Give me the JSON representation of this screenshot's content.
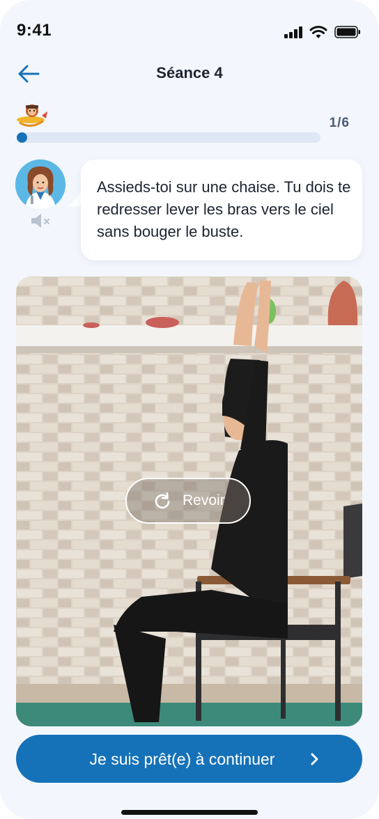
{
  "status_bar": {
    "time": "9:41"
  },
  "header": {
    "title": "Séance 4"
  },
  "progress": {
    "current": 1,
    "total": 6,
    "label": "1/6",
    "fraction": 0.0
  },
  "instruction": {
    "text": "Assieds-toi sur une chaise. Tu dois te redresser lever les bras vers le ciel sans bouger le buste."
  },
  "video": {
    "replay_label": "Revoir"
  },
  "footer": {
    "cta_label": "Je suis prêt(e) à continuer"
  },
  "colors": {
    "primary": "#1672b8",
    "background": "#f3f7fd",
    "track": "#dfe7f5"
  },
  "icons": [
    "back-arrow-icon",
    "mascot-icon",
    "coach-avatar",
    "volume-muted-icon",
    "replay-icon",
    "chevron-right-icon"
  ]
}
